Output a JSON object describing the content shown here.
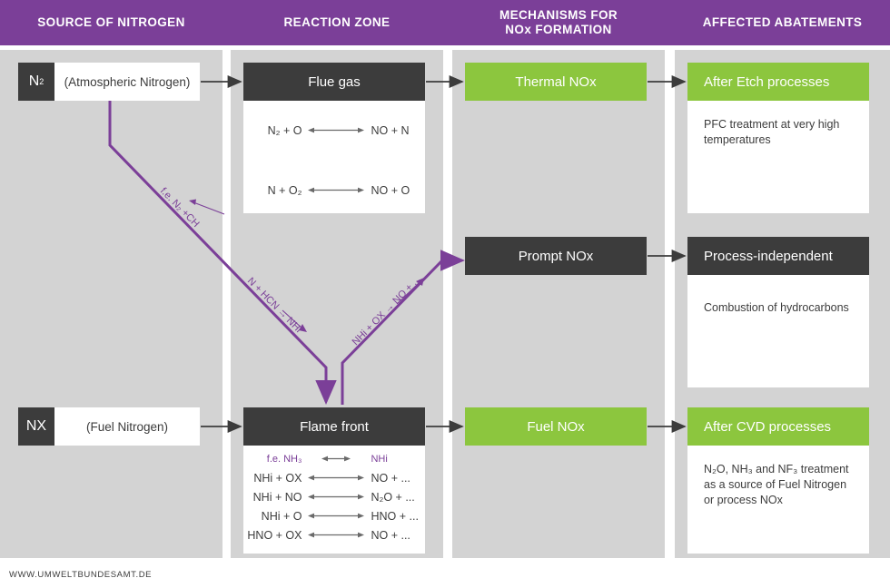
{
  "colors": {
    "purple": "#7b3f98",
    "green": "#8cc63e",
    "dark": "#3c3c3c",
    "panel": "#d3d3d3",
    "white": "#ffffff"
  },
  "header": {
    "columns": [
      {
        "line1": "SOURCE OF NITROGEN",
        "line2": ""
      },
      {
        "line1": "REACTION ZONE",
        "line2": ""
      },
      {
        "line1": "MECHANISMS FOR",
        "line2": "NOx FORMATION"
      },
      {
        "line1": "AFFECTED ABATEMENTS",
        "line2": ""
      }
    ]
  },
  "sources": [
    {
      "tag": "N",
      "tag_sub": "2",
      "label": "(Atmospheric Nitrogen)"
    },
    {
      "tag": "NX",
      "tag_sub": "",
      "label": "(Fuel Nitrogen)"
    }
  ],
  "reaction_zones": [
    {
      "title": "Flue gas",
      "reactions": [
        {
          "left": "N₂ + O",
          "arrow": "double",
          "right": "NO + N"
        },
        {
          "left": "N + O₂",
          "arrow": "double",
          "right": "NO + O"
        }
      ]
    },
    {
      "title": "Flame front",
      "reactions": [
        {
          "left": "f.e. NH₃",
          "arrow": "double",
          "right": "NHi",
          "highlight": true
        },
        {
          "left": "NHi + OX",
          "arrow": "double",
          "right": "NO + ..."
        },
        {
          "left": "NHi + NO",
          "arrow": "double",
          "right": "N₂O + ..."
        },
        {
          "left": "NHi + O",
          "arrow": "double",
          "right": "HNO + ..."
        },
        {
          "left": "HNO + OX",
          "arrow": "double",
          "right": "NO + ..."
        }
      ]
    }
  ],
  "mechanisms": [
    {
      "label": "Thermal NOx",
      "style": "green"
    },
    {
      "label": "Prompt NOx",
      "style": "dark"
    },
    {
      "label": "Fuel NOx",
      "style": "green"
    }
  ],
  "abatements": [
    {
      "title": "After Etch processes",
      "style": "green",
      "body": "PFC treatment at very high temperatures"
    },
    {
      "title": "Process-independent",
      "style": "dark",
      "body": "Combustion of hydrocarbons"
    },
    {
      "title": "After CVD processes",
      "style": "green",
      "body": "N₂O, NH₃ and NF₃ treatment as a source of Fuel Nitrogen or process NOx"
    }
  ],
  "pathway_labels": [
    {
      "id": "n2-ch",
      "text": "f.e. N₂ +CH"
    },
    {
      "id": "n-hcn-nhi",
      "text": "N + HCN → NHi"
    },
    {
      "id": "nhi-ox-no",
      "text": "NHi + OX → NO + ..."
    }
  ],
  "footer": {
    "text": "WWW.UMWELTBUNDESAMT.DE"
  }
}
